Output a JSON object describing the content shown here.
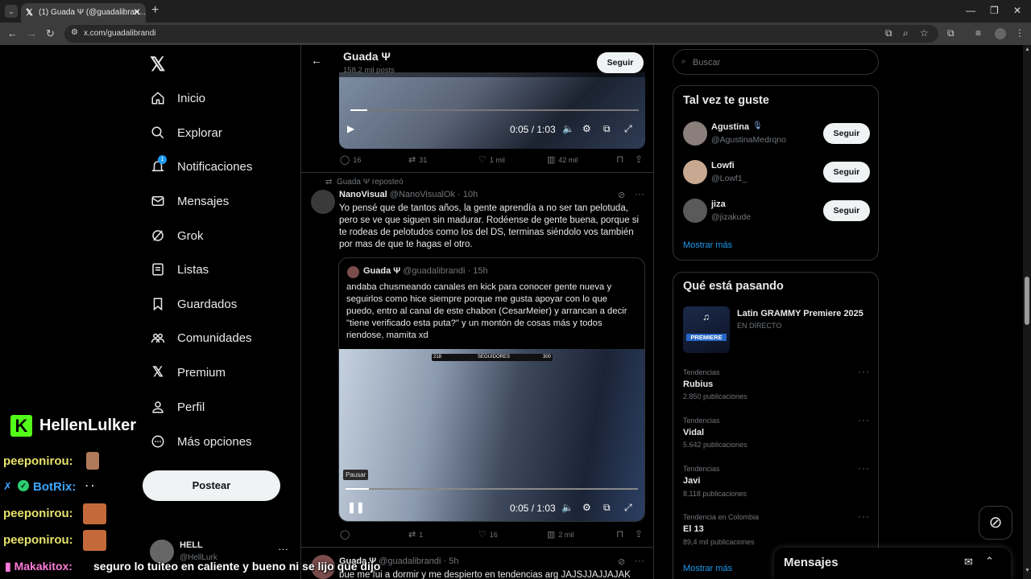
{
  "browser": {
    "tab_title": "(1) Guada Ψ (@guadalibran...",
    "url": "x.com/guadalibrandi"
  },
  "nav": {
    "items": [
      "Inicio",
      "Explorar",
      "Notificaciones",
      "Mensajes",
      "Grok",
      "Listas",
      "Guardados",
      "Comunidades",
      "Premium",
      "Perfil",
      "Más opciones"
    ],
    "notif_badge": "1",
    "post_label": "Postear",
    "account_name": "HELL",
    "account_handle": "@HellLurk"
  },
  "header": {
    "name": "Guada Ψ",
    "posts": "158,2 mil posts",
    "follow": "Seguir"
  },
  "top_video": {
    "time": "0:05 / 1:03",
    "stats": {
      "replies": "16",
      "reposts": "31",
      "likes": "1 mil",
      "views": "42 mil"
    }
  },
  "tweet": {
    "reposted_by": "Guada Ψ reposteó",
    "author": "NanoVisual",
    "handle": "@NanoVisualOk",
    "time": "· 10h",
    "text": "Yo pensé que de tantos años, la gente aprendía a no ser tan pelotuda, pero se ve que siguen sin madurar. Rodéense de gente buena, porque si te rodeas de pelotudos como los del DS, terminas siéndolo vos también por mas de que te hagas el otro.",
    "quote": {
      "author": "Guada Ψ",
      "handle": "@guadalibrandi",
      "time": "· 15h",
      "text": "andaba chusmeando canales en kick para conocer gente nueva y seguirlos como hice siempre porque me gusta apoyar con lo que puedo, entro al canal de este chabon (CesarMeier) y arrancan a decir \"tiene verificado esta puta?\" y un montón de cosas más y todos riendose, mamita xd",
      "video_overlay_left": "218",
      "video_overlay_mid": "SEGUIDORES",
      "video_overlay_right": "300",
      "tooltip": "Pausar",
      "time_label": "0:05 / 1:03"
    },
    "stats": {
      "replies": "",
      "reposts": "1",
      "likes": "16",
      "views": "2 mil"
    }
  },
  "next_tweet": {
    "author": "Guada Ψ",
    "handle": "@guadalibrandi",
    "time": "· 5h",
    "text": "bue me fui a dormir y me despierto en tendencias arg JAJSJJAJJAJAK"
  },
  "right": {
    "search_placeholder": "Buscar",
    "suggest_title": "Tal vez te guste",
    "suggestions": [
      {
        "name": "Agustina",
        "handle": "@AgustinaMedrqno",
        "btn": "Seguir"
      },
      {
        "name": "Lowfi",
        "handle": "@Lowf1_",
        "btn": "Seguir"
      },
      {
        "name": "jiza",
        "handle": "@jizakude",
        "btn": "Seguir"
      }
    ],
    "show_more": "Mostrar más",
    "trends_title": "Qué está pasando",
    "event": {
      "title": "Latin GRAMMY Premiere 2025",
      "status": "EN DIRECTO",
      "img_text": "PREMIERE"
    },
    "trends": [
      {
        "meta": "Tendencias",
        "name": "Rubius",
        "count": "2.850 publicaciones"
      },
      {
        "meta": "Tendencias",
        "name": "Vidal",
        "count": "5.642 publicaciones"
      },
      {
        "meta": "Tendencias",
        "name": "Javi",
        "count": "8.118 publicaciones"
      },
      {
        "meta": "Tendencia en Colombia",
        "name": "El 13",
        "count": "89,4 mil publicaciones"
      }
    ],
    "show_more2": "Mostrar más",
    "messages": "Mensajes"
  },
  "stream": {
    "channel": "HellenLulker",
    "chat": [
      {
        "user": "peeponirou:",
        "msg": ""
      },
      {
        "user": "BotRix:",
        "msg": "· ·"
      },
      {
        "user": "peeponirou:",
        "msg": ""
      },
      {
        "user": "peeponirou:",
        "msg": ""
      },
      {
        "user": "Makakitox:",
        "msg": "seguro lo tuiteo en caliente y bueno ni se lijo que dijo"
      }
    ]
  }
}
